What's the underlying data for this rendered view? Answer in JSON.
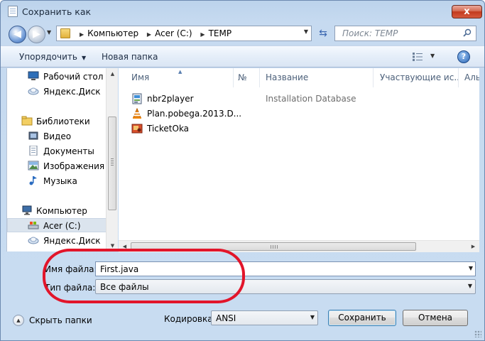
{
  "window": {
    "title": "Сохранить как",
    "close_label": "x"
  },
  "address": {
    "parts": [
      "Компьютер",
      "Acer (C:)",
      "TEMP"
    ]
  },
  "search": {
    "placeholder": "Поиск: TEMP"
  },
  "toolbar": {
    "organize": "Упорядочить",
    "new_folder": "Новая папка",
    "help": "?"
  },
  "nav": {
    "items": [
      {
        "label": "Рабочий стол",
        "icon": "desktop-icon"
      },
      {
        "label": "Яндекс.Диск",
        "icon": "yandex-disk-icon"
      },
      {
        "label": "Библиотеки",
        "icon": "libraries-icon"
      },
      {
        "label": "Видео",
        "icon": "video-icon"
      },
      {
        "label": "Документы",
        "icon": "documents-icon"
      },
      {
        "label": "Изображения",
        "icon": "images-icon"
      },
      {
        "label": "Музыка",
        "icon": "music-icon"
      },
      {
        "label": "Компьютер",
        "icon": "computer-icon"
      },
      {
        "label": "Acer (C:)",
        "icon": "drive-icon",
        "selected": true
      },
      {
        "label": "Яндекс.Диск",
        "icon": "yandex-disk-icon"
      }
    ]
  },
  "columns": [
    "Имя",
    "№",
    "Название",
    "Участвующие ис...",
    "Аль"
  ],
  "files": [
    {
      "name": "nbr2player",
      "type": "Installation Database",
      "icon": "installer-icon"
    },
    {
      "name": "Plan.pobega.2013.D...",
      "type": "",
      "icon": "vlc-icon"
    },
    {
      "name": "TicketOka",
      "type": "",
      "icon": "image-file-icon"
    }
  ],
  "form": {
    "filename_label": "Имя файла:",
    "filename_value": "First.java",
    "filetype_label": "Тип файла:",
    "filetype_value": "Все файлы",
    "encoding_label": "Кодировка:",
    "encoding_value": "ANSI",
    "save_button": "Сохранить",
    "cancel_button": "Отмена",
    "hide_folders": "Скрыть папки"
  },
  "colors": {
    "accent": "#3c7fb1",
    "annotation": "#e2152a",
    "selection": "#dbe4ee"
  }
}
